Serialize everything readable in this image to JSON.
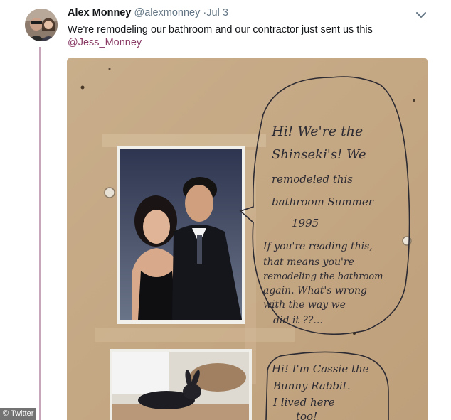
{
  "tweet": {
    "author_name": "Alex Monney",
    "handle": "@alexmonney",
    "separator": "·",
    "date": "Jul 3",
    "text": "We're remodeling our bathroom and our contractor just sent us this",
    "mention": "@Jess_Monney"
  },
  "photo_note": {
    "lines_1": [
      "Hi! We're the",
      "Shinseki's! We",
      "remodeled this",
      "bathroom Summer",
      "1995"
    ],
    "lines_2": [
      "If you're reading this,",
      "that means you're",
      "remodeling the bathroom",
      "again. What's wrong",
      "with the way we",
      "did it ??..."
    ],
    "lines_3": [
      "Hi! I'm Cassie the",
      "Bunny Rabbit.",
      "I lived here",
      "too!"
    ]
  },
  "watermark": "© Twitter",
  "colors": {
    "link": "#8a3c66",
    "thread_line": "#c6a6b8",
    "drywall": "#c8ad8a",
    "ink": "#2c2a32"
  },
  "icons": {
    "menu": "chevron-down-icon"
  }
}
